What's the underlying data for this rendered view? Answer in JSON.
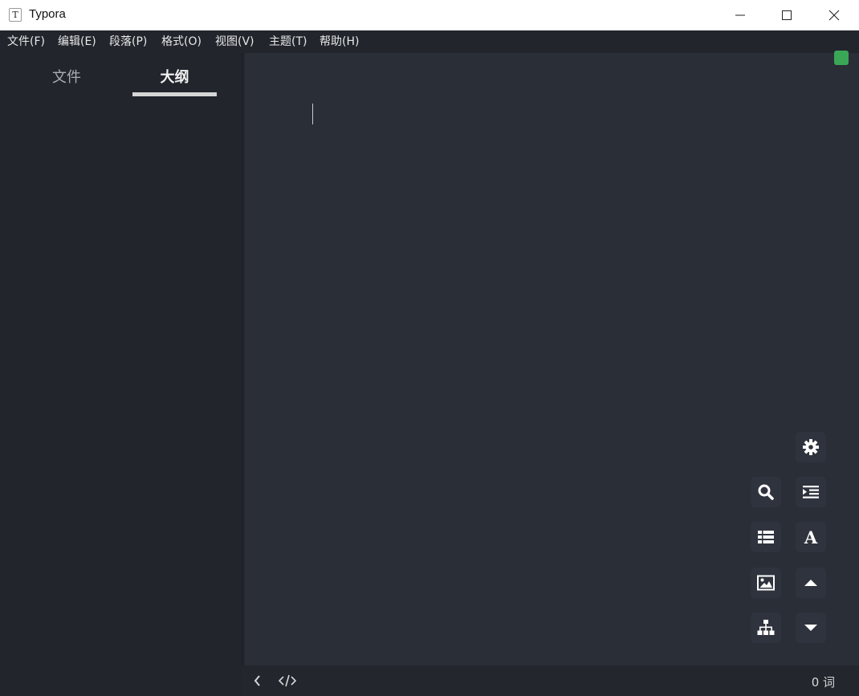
{
  "window": {
    "app_icon_letter": "T",
    "title": "Typora"
  },
  "menubar": {
    "items": [
      "文件(F)",
      "编辑(E)",
      "段落(P)",
      "格式(O)",
      "视图(V)",
      "主题(T)",
      "帮助(H)"
    ]
  },
  "sidebar": {
    "tabs": [
      {
        "label": "文件",
        "active": false
      },
      {
        "label": "大纲",
        "active": true
      }
    ]
  },
  "editor": {
    "status_color": "#3aa757"
  },
  "tools": [
    {
      "name": "settings",
      "icon": "gear-icon"
    },
    {
      "name": "search",
      "icon": "search-icon"
    },
    {
      "name": "indent",
      "icon": "indent-icon"
    },
    {
      "name": "table",
      "icon": "table-icon"
    },
    {
      "name": "font",
      "icon": "font-icon"
    },
    {
      "name": "image",
      "icon": "image-icon"
    },
    {
      "name": "scroll-up",
      "icon": "caret-up-icon"
    },
    {
      "name": "diagram",
      "icon": "sitemap-icon"
    },
    {
      "name": "scroll-down",
      "icon": "caret-down-icon"
    }
  ],
  "footer": {
    "word_count": "0 词"
  },
  "colors": {
    "editor_bg": "#2a2e37",
    "sidebar_bg": "#22252c",
    "accent_green": "#3aa757"
  }
}
